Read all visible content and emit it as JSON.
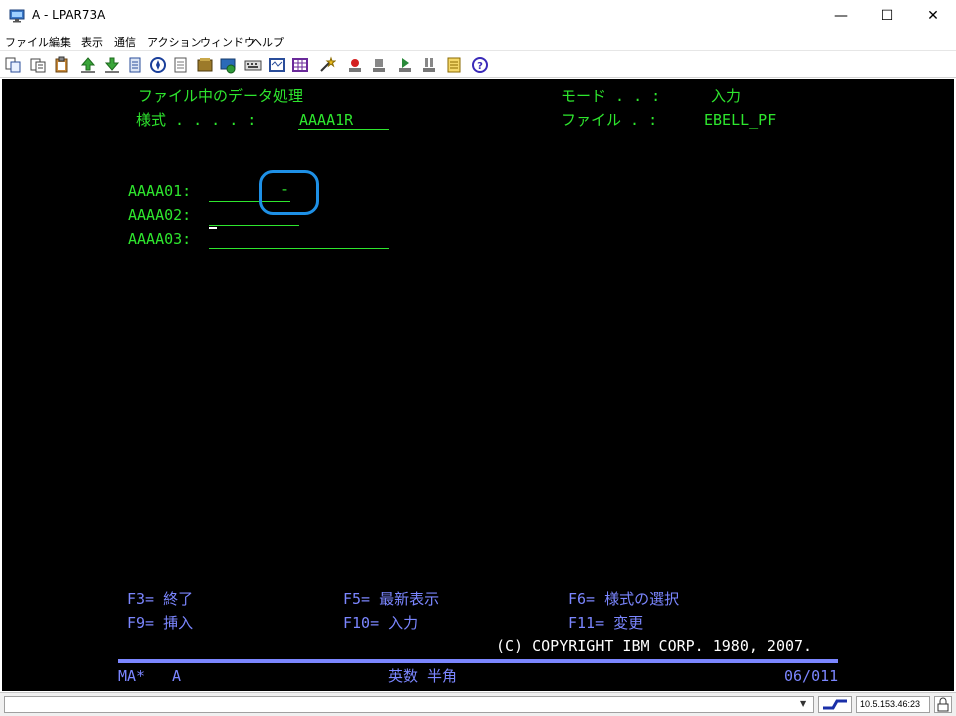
{
  "window": {
    "title": "A - LPAR73A",
    "minimize_glyph": "—",
    "maximize_glyph": "☐",
    "close_glyph": "✕"
  },
  "menu": [
    "ファイル",
    "編集",
    "表示",
    "通信",
    "アクション",
    "ウィンドウ",
    "ヘルプ"
  ],
  "toolbar_icons": [
    "copy-icon",
    "paste-icon",
    "clipboard-icon",
    "send-file-icon",
    "receive-file-icon",
    "macro-icon",
    "compass-icon",
    "document-icon",
    "book-icon",
    "settings-icon",
    "keyboard-icon",
    "grid-icon",
    "wand-icon",
    "record-icon",
    "stop-icon",
    "play-icon",
    "pause-icon",
    "notes-icon",
    "help-icon"
  ],
  "terminal": {
    "program_title": "ファイル中のデータ処理",
    "format_label": "様式 . . . . :",
    "format_value": "AAAA1R",
    "mode_label": "モード . . :",
    "mode_value": "入力",
    "file_label": "ファイル . :",
    "file_value": "EBELL_PF",
    "fields": [
      {
        "label": "AAAA01:",
        "value": "-"
      },
      {
        "label": "AAAA02:",
        "value": ""
      },
      {
        "label": "AAAA03:",
        "value": ""
      }
    ],
    "function_keys": [
      {
        "key": "F3=",
        "label": "終了"
      },
      {
        "key": "F5=",
        "label": "最新表示"
      },
      {
        "key": "F6=",
        "label": "様式の選択"
      },
      {
        "key": "F9=",
        "label": "挿入"
      },
      {
        "key": "F10=",
        "label": "入力"
      },
      {
        "key": "F11=",
        "label": "変更"
      }
    ],
    "copyright": "(C) COPYRIGHT IBM CORP. 1980, 2007.",
    "oia": {
      "session": "MA*",
      "session_letter": "A",
      "input_mode": "英数 半角",
      "cursor_position": "06/011"
    }
  },
  "statusbar": {
    "arrow": "▼",
    "ip": "10.5.153.46:23"
  },
  "colors": {
    "terminal_green": "#2ee62e",
    "terminal_blue": "#7b86ff",
    "highlight": "#1e90e6"
  }
}
